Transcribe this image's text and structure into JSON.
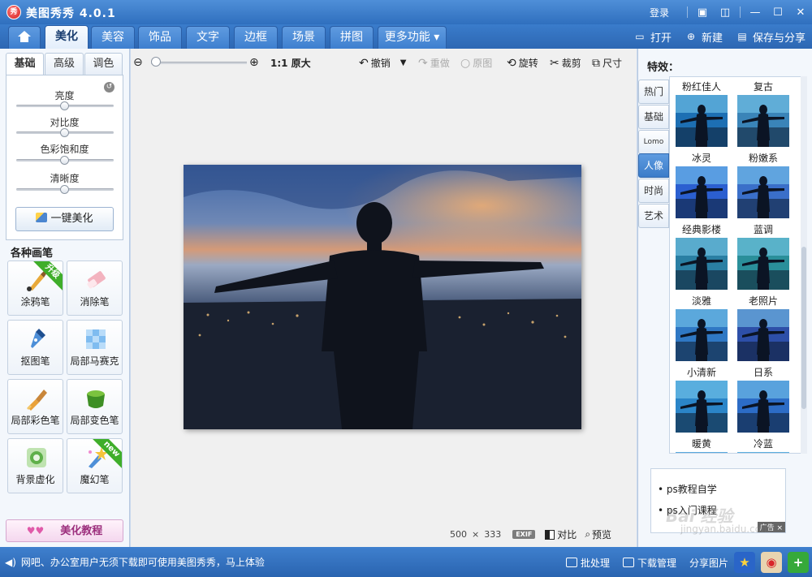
{
  "app": {
    "title": "美图秀秀 4.0.1",
    "logo_glyph": "秀",
    "login": "登录"
  },
  "main_tabs": [
    {
      "label": "美化",
      "active": true
    },
    {
      "label": "美容"
    },
    {
      "label": "饰品"
    },
    {
      "label": "文字"
    },
    {
      "label": "边框"
    },
    {
      "label": "场景"
    },
    {
      "label": "拼图"
    },
    {
      "label": "更多功能 ▾"
    }
  ],
  "file_actions": {
    "open": "打开",
    "new": "新建",
    "save_share": "保存与分享"
  },
  "left": {
    "subtabs": [
      "基础",
      "高级",
      "调色"
    ],
    "sliders": [
      {
        "label": "亮度",
        "value": 0.5
      },
      {
        "label": "对比度",
        "value": 0.5
      },
      {
        "label": "色彩饱和度",
        "value": 0.5
      },
      {
        "label": "清晰度",
        "value": 0.5
      }
    ],
    "one_click": "一键美化",
    "brushes_title": "各种画笔",
    "brushes": [
      {
        "label": "涂鸦笔",
        "badge": "升级"
      },
      {
        "label": "消除笔"
      },
      {
        "label": "抠图笔"
      },
      {
        "label": "局部马赛克"
      },
      {
        "label": "局部彩色笔"
      },
      {
        "label": "局部变色笔"
      },
      {
        "label": "背景虚化"
      },
      {
        "label": "魔幻笔",
        "badge": "new"
      }
    ],
    "tutorial": "美化教程"
  },
  "toolbar": {
    "actual_size": "1:1 原大",
    "undo": "撤销",
    "redo": "重做",
    "original": "原图",
    "rotate": "旋转",
    "crop": "裁剪",
    "resize": "尺寸",
    "zoom": 0.05
  },
  "image_info": {
    "width": "500",
    "x": "×",
    "height": "333",
    "exif": "EXIF",
    "compare": "对比",
    "preview": "预览"
  },
  "effects": {
    "title": "特效：",
    "categories": [
      {
        "label": "热门"
      },
      {
        "label": "基础"
      },
      {
        "label": "Lomo"
      },
      {
        "label": "人像",
        "active": true
      },
      {
        "label": "时尚"
      },
      {
        "label": "艺术"
      }
    ],
    "items": [
      {
        "name": "粉红佳人",
        "tint": "#1d6fb3"
      },
      {
        "name": "复古",
        "tint": "#3a84b8"
      },
      {
        "name": "冰灵",
        "tint": "#2b5fd0"
      },
      {
        "name": "粉嫩系",
        "tint": "#3a6fc9"
      },
      {
        "name": "经典影楼",
        "tint": "#2a7fa3"
      },
      {
        "name": "蓝调",
        "tint": "#2a8f9a"
      },
      {
        "name": "淡雅",
        "tint": "#2f78c4"
      },
      {
        "name": "老照片",
        "tint": "#2d4fa8"
      },
      {
        "name": "小清新",
        "tint": "#2b85c8"
      },
      {
        "name": "日系",
        "tint": "#2c6cc6"
      },
      {
        "name": "暖黄",
        "tint": "#2c7ac6"
      },
      {
        "name": "冷蓝",
        "tint": "#2f86c9"
      }
    ],
    "ad_links": [
      "ps教程自学",
      "ps入门课程"
    ],
    "ad_close": "广告 ×"
  },
  "watermark": {
    "brand": "Bai 经验",
    "url": "jingyan.baidu.com"
  },
  "status": {
    "message": "网吧、办公室用户无须下载即可使用美图秀秀，马上体验",
    "batch": "批处理",
    "download": "下载管理",
    "share": "分享图片"
  }
}
